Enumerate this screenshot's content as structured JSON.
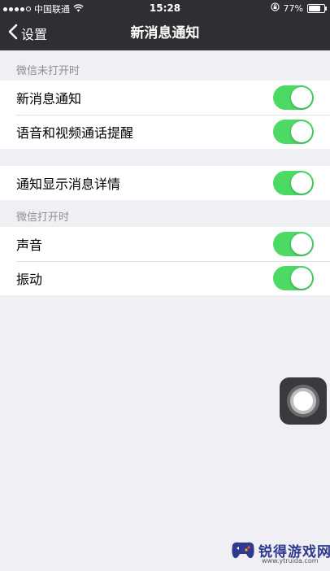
{
  "status_bar": {
    "carrier": "中国联通",
    "time": "15:28",
    "battery_percent": "77%",
    "battery_level": 0.77,
    "signal_bars_filled": 4,
    "signal_bars_total": 5,
    "icons": [
      "wifi-icon",
      "orientation-lock-icon",
      "battery-icon"
    ]
  },
  "nav": {
    "back_label": "设置",
    "title": "新消息通知"
  },
  "sections": [
    {
      "header": "微信未打开时",
      "items": [
        {
          "label": "新消息通知",
          "on": true
        },
        {
          "label": "语音和视频通话提醒",
          "on": true
        }
      ]
    },
    {
      "header": "",
      "items": [
        {
          "label": "通知显示消息详情",
          "on": true
        }
      ]
    },
    {
      "header": "微信打开时",
      "items": [
        {
          "label": "声音",
          "on": true
        },
        {
          "label": "振动",
          "on": true
        }
      ]
    }
  ],
  "colors": {
    "bar_bg": "#2e2e33",
    "page_bg": "#efeff4",
    "toggle_on": "#4cd964",
    "section_header": "#8e8e93"
  },
  "watermark": {
    "text": "锐得游戏网",
    "url": "www.ytruida.com"
  }
}
